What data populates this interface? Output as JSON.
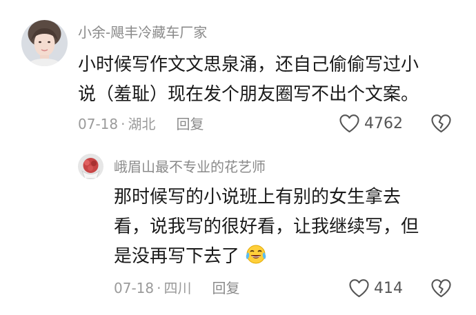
{
  "comments": [
    {
      "username": "小余-飓丰冷藏车厂家",
      "text_lines": [
        "小时候写作文文思泉涌，还自己偷偷写过小",
        "说（羞耻）现在发个朋友圈写不出个文案。"
      ],
      "date": "07-18",
      "separator": "·",
      "location": "湖北",
      "reply_label": "回复",
      "like_count": "4762",
      "avatar_icon": "woman-portrait-avatar"
    },
    {
      "username": "峨眉山最不专业的花艺师",
      "text_lines": [
        "那时候写的小说班上有别的女生拿去",
        "看，说我写的很好看，让我继续写，但",
        "是没再写下去了"
      ],
      "emoji": "crying-laughing-emoji",
      "date": "07-18",
      "separator": "·",
      "location": "四川",
      "reply_label": "回复",
      "like_count": "414",
      "avatar_icon": "flower-bouquet-avatar"
    }
  ],
  "icons": {
    "like": "heart-outline-icon",
    "dislike": "broken-heart-icon"
  },
  "colors": {
    "username": "#8a8a8a",
    "meta": "#9a9a9a",
    "text": "#1a1a1a"
  }
}
